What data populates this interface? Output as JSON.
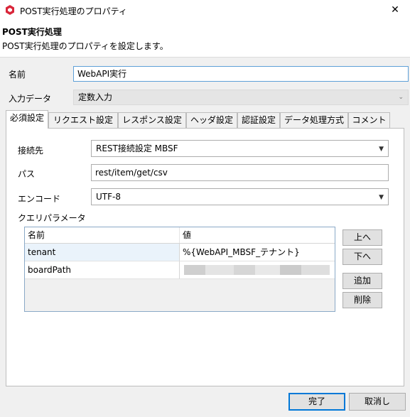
{
  "window": {
    "title": "POST実行処理のプロパティ",
    "close_glyph": "✕"
  },
  "header": {
    "title": "POST実行処理",
    "description": "POST実行処理のプロパティを設定します。"
  },
  "form": {
    "name_label": "名前",
    "name_value": "WebAPI実行",
    "input_label": "入力データ",
    "input_value": "定数入力"
  },
  "tabs": [
    {
      "label": "必須設定",
      "active": true
    },
    {
      "label": "リクエスト設定"
    },
    {
      "label": "レスポンス設定"
    },
    {
      "label": "ヘッダ設定"
    },
    {
      "label": "認証設定"
    },
    {
      "label": "データ処理方式"
    },
    {
      "label": "コメント"
    }
  ],
  "settings": {
    "connection_label": "接続先",
    "connection_value": "REST接続設定 MBSF",
    "path_label": "パス",
    "path_value": "rest/item/get/csv",
    "encode_label": "エンコード",
    "encode_value": "UTF-8",
    "query_label": "クエリパラメータ"
  },
  "query_table": {
    "columns": [
      "名前",
      "値"
    ],
    "rows": [
      {
        "name": "tenant",
        "value": "%{WebAPI_MBSF_テナント}"
      },
      {
        "name": "boardPath",
        "value": ""
      }
    ]
  },
  "side_buttons": {
    "up": "上へ",
    "down": "下へ",
    "add": "追加",
    "delete": "削除"
  },
  "footer": {
    "ok": "完了",
    "cancel": "取消し"
  },
  "icons": {
    "app": "red-hexagon-icon",
    "dropdown": "chevron-down-icon"
  },
  "colors": {
    "app_icon": "#d9263a",
    "focus_border": "#5ea0d8",
    "primary_border": "#0078d7"
  }
}
